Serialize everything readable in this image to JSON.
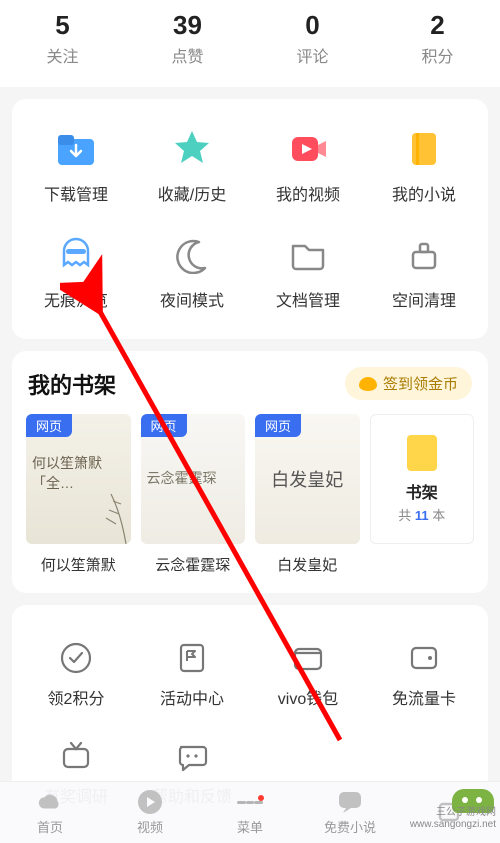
{
  "stats": [
    {
      "value": "5",
      "label": "关注"
    },
    {
      "value": "39",
      "label": "点赞"
    },
    {
      "value": "0",
      "label": "评论"
    },
    {
      "value": "2",
      "label": "积分"
    }
  ],
  "features_row1": [
    {
      "name": "download-manager",
      "label": "下载管理"
    },
    {
      "name": "favorites-history",
      "label": "收藏/历史"
    },
    {
      "name": "my-videos",
      "label": "我的视频"
    },
    {
      "name": "my-novels",
      "label": "我的小说"
    }
  ],
  "features_row2": [
    {
      "name": "incognito",
      "label": "无痕浏览"
    },
    {
      "name": "night-mode",
      "label": "夜间模式"
    },
    {
      "name": "doc-manager",
      "label": "文档管理"
    },
    {
      "name": "space-cleanup",
      "label": "空间清理"
    }
  ],
  "bookshelf": {
    "title": "我的书架",
    "signin": "签到领金币",
    "tag": "网页",
    "books": [
      {
        "cover_text": "何以笙箫默「全…",
        "title": "何以笙箫默"
      },
      {
        "cover_text": "云念霍霆琛",
        "title": "云念霍霆琛"
      },
      {
        "cover_text": "白发皇妃",
        "title": "白发皇妃"
      }
    ],
    "shelf_tile": {
      "title": "书架",
      "prefix": "共 ",
      "count": "11",
      "suffix": " 本"
    }
  },
  "tools_row1": [
    {
      "name": "earn-points",
      "label": "领2积分"
    },
    {
      "name": "activity-center",
      "label": "活动中心"
    },
    {
      "name": "vivo-wallet",
      "label": "vivo钱包"
    },
    {
      "name": "data-free-card",
      "label": "免流量卡"
    }
  ],
  "tools_row2": [
    {
      "name": "reward-survey",
      "label": "有奖调研"
    },
    {
      "name": "help-feedback",
      "label": "帮助和反馈"
    }
  ],
  "nav": [
    {
      "name": "home",
      "label": "首页"
    },
    {
      "name": "video",
      "label": "视频"
    },
    {
      "name": "menu",
      "label": "菜单"
    },
    {
      "name": "free-novel",
      "label": "免费小说"
    },
    {
      "name": "fifth",
      "label": ""
    }
  ],
  "watermark": {
    "brand": "三公子游戏网",
    "url": "www.sangongzi.net"
  }
}
